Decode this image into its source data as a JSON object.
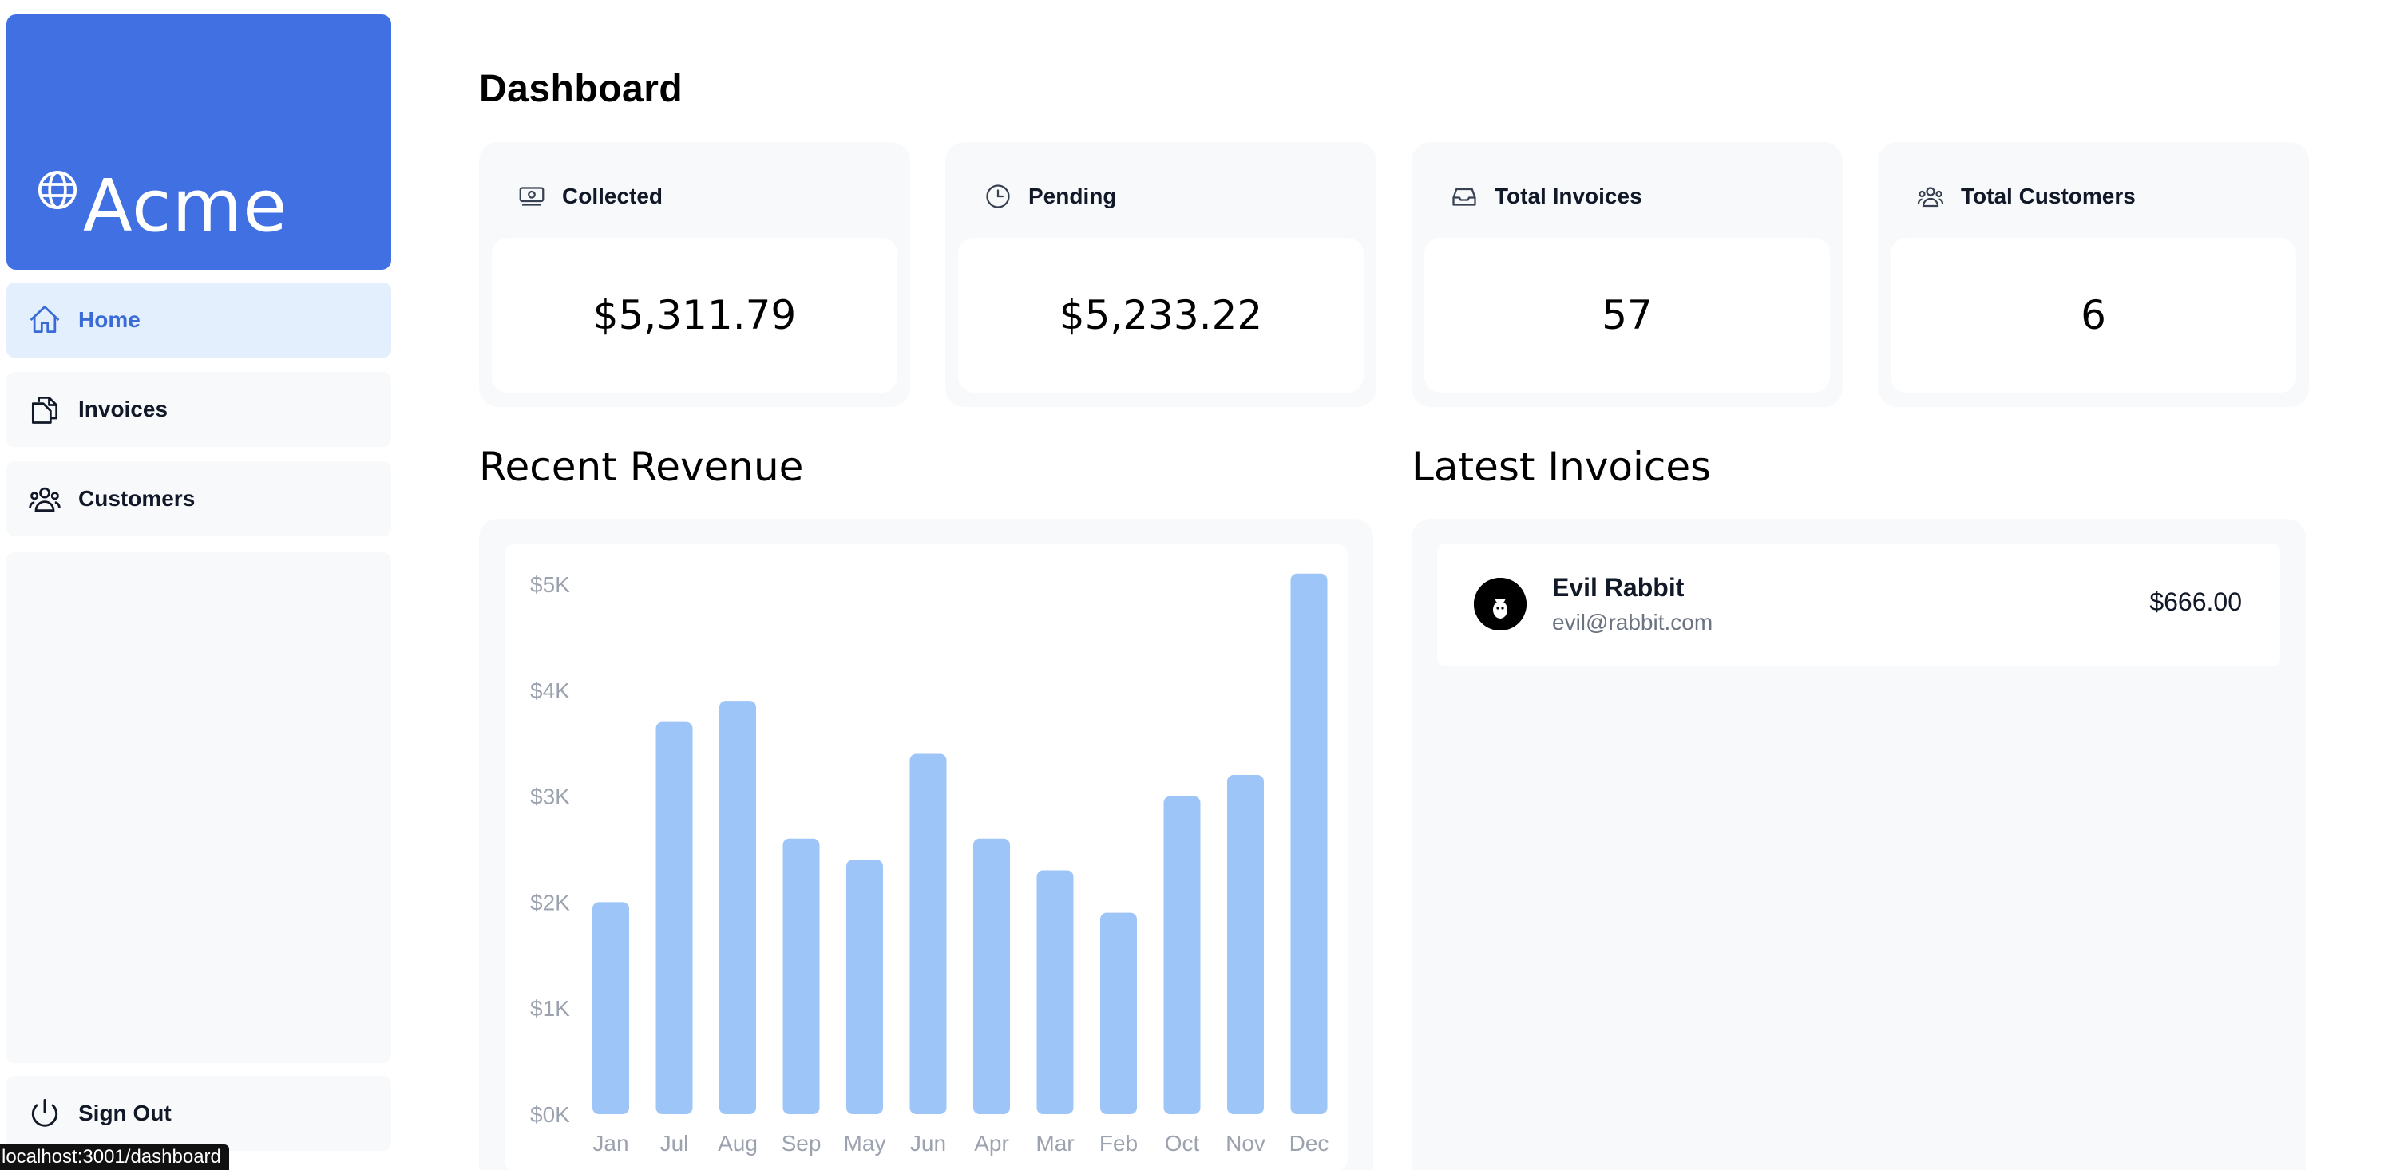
{
  "brand": {
    "name": "Acme",
    "color": "#4170e3"
  },
  "sidebar": {
    "items": [
      {
        "label": "Home",
        "icon": "home-icon",
        "active": true
      },
      {
        "label": "Invoices",
        "icon": "document-duplicate-icon",
        "active": false
      },
      {
        "label": "Customers",
        "icon": "user-group-icon",
        "active": false
      }
    ],
    "sign_out": {
      "label": "Sign Out",
      "icon": "power-icon"
    }
  },
  "page": {
    "title": "Dashboard"
  },
  "cards": [
    {
      "label": "Collected",
      "value": "$5,311.79",
      "icon": "banknotes-icon"
    },
    {
      "label": "Pending",
      "value": "$5,233.22",
      "icon": "clock-icon"
    },
    {
      "label": "Total Invoices",
      "value": "57",
      "icon": "inbox-icon"
    },
    {
      "label": "Total Customers",
      "value": "6",
      "icon": "user-group-icon"
    }
  ],
  "revenue": {
    "title": "Recent Revenue",
    "chart_data": {
      "type": "bar",
      "title": "",
      "xlabel": "",
      "ylabel": "",
      "categories": [
        "Jan",
        "Jul",
        "Aug",
        "Sep",
        "May",
        "Jun",
        "Apr",
        "Mar",
        "Feb",
        "Oct",
        "Nov",
        "Dec"
      ],
      "values": [
        2000,
        3700,
        3900,
        2600,
        2400,
        3400,
        2600,
        2300,
        1900,
        3000,
        3200,
        5100
      ],
      "y_ticks": [
        "$5K",
        "$4K",
        "$3K",
        "$2K",
        "$1K",
        "$0K"
      ],
      "ylim": [
        0,
        5000
      ],
      "bar_color": "#9ec5f7",
      "grid": false
    }
  },
  "latest_invoices": {
    "title": "Latest Invoices",
    "rows": [
      {
        "name": "Evil Rabbit",
        "email": "evil@rabbit.com",
        "amount": "$666.00",
        "avatar": "evil-rabbit-avatar"
      }
    ]
  },
  "status_bar": {
    "url": "localhost:3001/dashboard"
  }
}
